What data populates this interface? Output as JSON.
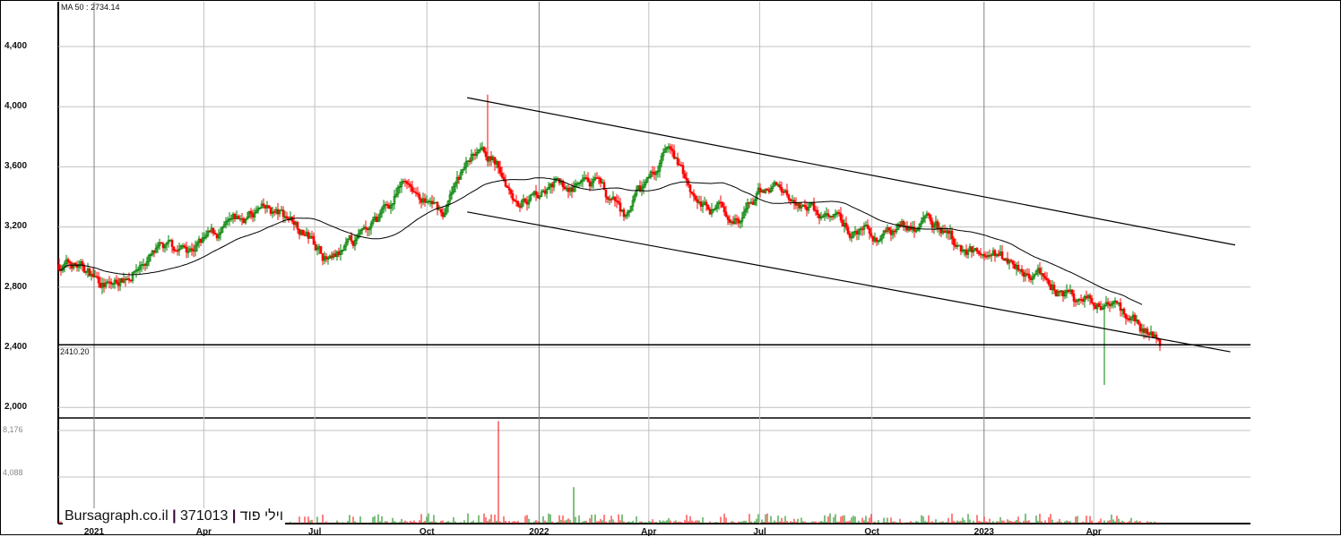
{
  "chart_data": {
    "type": "candlestick",
    "title": "",
    "indicator_label": "MA 50 : 2734.14",
    "last_price_label": "2410.20",
    "watermark": {
      "site": "Bursagraph.co.il",
      "code": "371013",
      "name": "וילי פוד"
    },
    "y_ticks": [
      "4,400",
      "4,000",
      "3,600",
      "3,200",
      "2,800",
      "2,400",
      "2,000"
    ],
    "y_tick_values": [
      4400,
      4000,
      3600,
      3200,
      2800,
      2400,
      2000
    ],
    "ylim": [
      1930,
      4710
    ],
    "volume_ticks": [
      "8,176",
      "4,088"
    ],
    "volume_tick_values": [
      8176,
      4088
    ],
    "x_ticks": [
      {
        "label": "2021",
        "date": "2021-01-01",
        "major": true
      },
      {
        "label": "Apr",
        "date": "2021-04-01",
        "major": false
      },
      {
        "label": "Jul",
        "date": "2021-07-01",
        "major": false
      },
      {
        "label": "Oct",
        "date": "2021-10-01",
        "major": false
      },
      {
        "label": "2022",
        "date": "2022-01-01",
        "major": true
      },
      {
        "label": "Apr",
        "date": "2022-04-01",
        "major": false
      },
      {
        "label": "Jul",
        "date": "2022-07-01",
        "major": false
      },
      {
        "label": "Oct",
        "date": "2022-10-01",
        "major": false
      },
      {
        "label": "2023",
        "date": "2023-01-01",
        "major": true
      },
      {
        "label": "Apr",
        "date": "2023-04-01",
        "major": false
      }
    ],
    "monthly_closes": {
      "dates": [
        "2020-12",
        "2021-01",
        "2021-02",
        "2021-03",
        "2021-04",
        "2021-05",
        "2021-06",
        "2021-07",
        "2021-08",
        "2021-09",
        "2021-10",
        "2021-11",
        "2021-12",
        "2022-01",
        "2022-02",
        "2022-03",
        "2022-04",
        "2022-05",
        "2022-06",
        "2022-07",
        "2022-08",
        "2022-09",
        "2022-10",
        "2022-11",
        "2022-12",
        "2023-01",
        "2023-02",
        "2023-03",
        "2023-04",
        "2023-05"
      ],
      "values": [
        2950,
        2800,
        3000,
        3050,
        3150,
        3300,
        3250,
        2950,
        3150,
        3500,
        3300,
        3800,
        3400,
        3450,
        3450,
        3250,
        3700,
        3350,
        3300,
        3500,
        3300,
        3150,
        3150,
        3250,
        3050,
        3000,
        2900,
        2700,
        2700,
        2480
      ]
    },
    "extremes": {
      "high": {
        "date": "2021-11-20",
        "value": 4080
      },
      "spike_low": {
        "date": "2023-04-10",
        "value": 2150
      }
    },
    "ma_period": 50,
    "ma_last": 2734.14,
    "last_close": 2410.2,
    "channel": {
      "upper": [
        {
          "date": "2021-11-03",
          "value": 4060
        },
        {
          "date": "2023-07-26",
          "value": 3080
        }
      ],
      "lower": [
        {
          "date": "2021-11-03",
          "value": 3300
        },
        {
          "date": "2023-07-22",
          "value": 2370
        }
      ]
    },
    "volume_spikes": [
      {
        "date": "2021-11-28",
        "value": 9000
      },
      {
        "date": "2022-01-29",
        "value": 3200
      }
    ],
    "colors": {
      "up": "#008000",
      "down": "#ff0000",
      "ma": "#000000",
      "grid": "#c0c0c0",
      "grid_major": "#808080"
    }
  }
}
